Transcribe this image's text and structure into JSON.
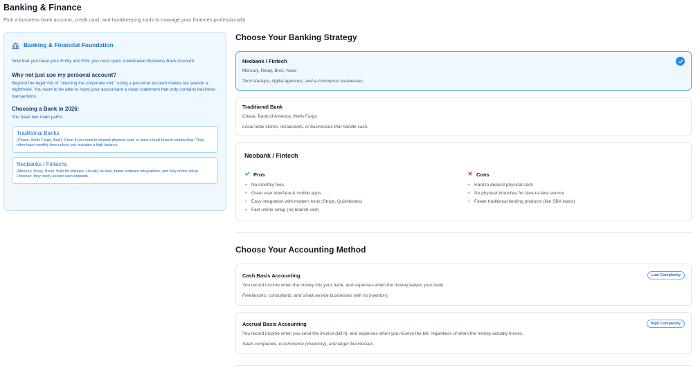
{
  "header": {
    "title": "Banking & Finance",
    "subtitle": "Pick a business bank account, credit card, and bookkeeping tools to manage your finances professionally."
  },
  "info_panel": {
    "icon": "bank-icon",
    "title": "Banking & Financial Foundation",
    "intro": "Now that you have your Entity and EIN, you must open a dedicated Business Bank Account.",
    "why_heading": "Why not just use my personal account?",
    "why_text": "Beyond the legal risk of \"piercing the corporate veil,\" using a personal account makes tax season a nightmare. You want to be able to hand your accountant a clean statement that only contains business transactions.",
    "choosing_heading": "Choosing a Bank in 2026:",
    "paths_intro": "You have two main paths:",
    "paths": [
      {
        "title": "Traditional Banks",
        "desc": "(Chase, Wells Fargo, BoA): Great if you need to deposit physical cash or want a local branch relationship. They often have monthly fees unless you maintain a high balance."
      },
      {
        "title": "Neobanks / Fintechs",
        "desc": "(Mercury, Relay, Brex): Built for startups. Usually no fees, better software integrations, and fully online setup. However, they rarely accept cash deposits."
      }
    ]
  },
  "banking": {
    "title": "Choose Your Banking Strategy",
    "options": [
      {
        "name": "Neobank / Fintech",
        "providers": "Mercury, Relay, Brex, Novo",
        "best_for": "Tech startups, digital agencies, and e-commerce businesses.",
        "selected": true
      },
      {
        "name": "Traditional Bank",
        "providers": "Chase, Bank of America, Wells Fargo",
        "best_for": "Local retail stores, restaurants, or businesses that handle cash.",
        "selected": false
      }
    ],
    "detail": {
      "title": "Neobank / Fintech",
      "pros_label": "Pros",
      "cons_label": "Cons",
      "pros": [
        "No monthly fees",
        "Great user interface & mobile apps",
        "Easy integration with modern tools (Stripe, Quickbooks)",
        "Fast online setup (no branch visit)"
      ],
      "cons": [
        "Hard to deposit physical cash",
        "No physical branches for face-to-face service",
        "Fewer traditional lending products (like SBA loans)"
      ]
    }
  },
  "accounting": {
    "title": "Choose Your Accounting Method",
    "options": [
      {
        "name": "Cash Basis Accounting",
        "badge": "Low Complexity",
        "desc": "You record income when the money hits your bank, and expenses when the money leaves your bank.",
        "best_for": "Freelancers, consultants, and small service businesses with no inventory."
      },
      {
        "name": "Accrual Basis Accounting",
        "badge": "High Complexity",
        "desc": "You record income when you send the invoice (bill it), and expenses when you receive the bill, regardless of when the money actually moves.",
        "best_for": "SaaS companies, e-commerce (inventory), and larger businesses."
      }
    ]
  },
  "colors": {
    "accent": "#1d8ce8",
    "panel_bg": "#f0f8ff",
    "pros_check": "#16a34a",
    "cons_x": "#dc2626"
  }
}
